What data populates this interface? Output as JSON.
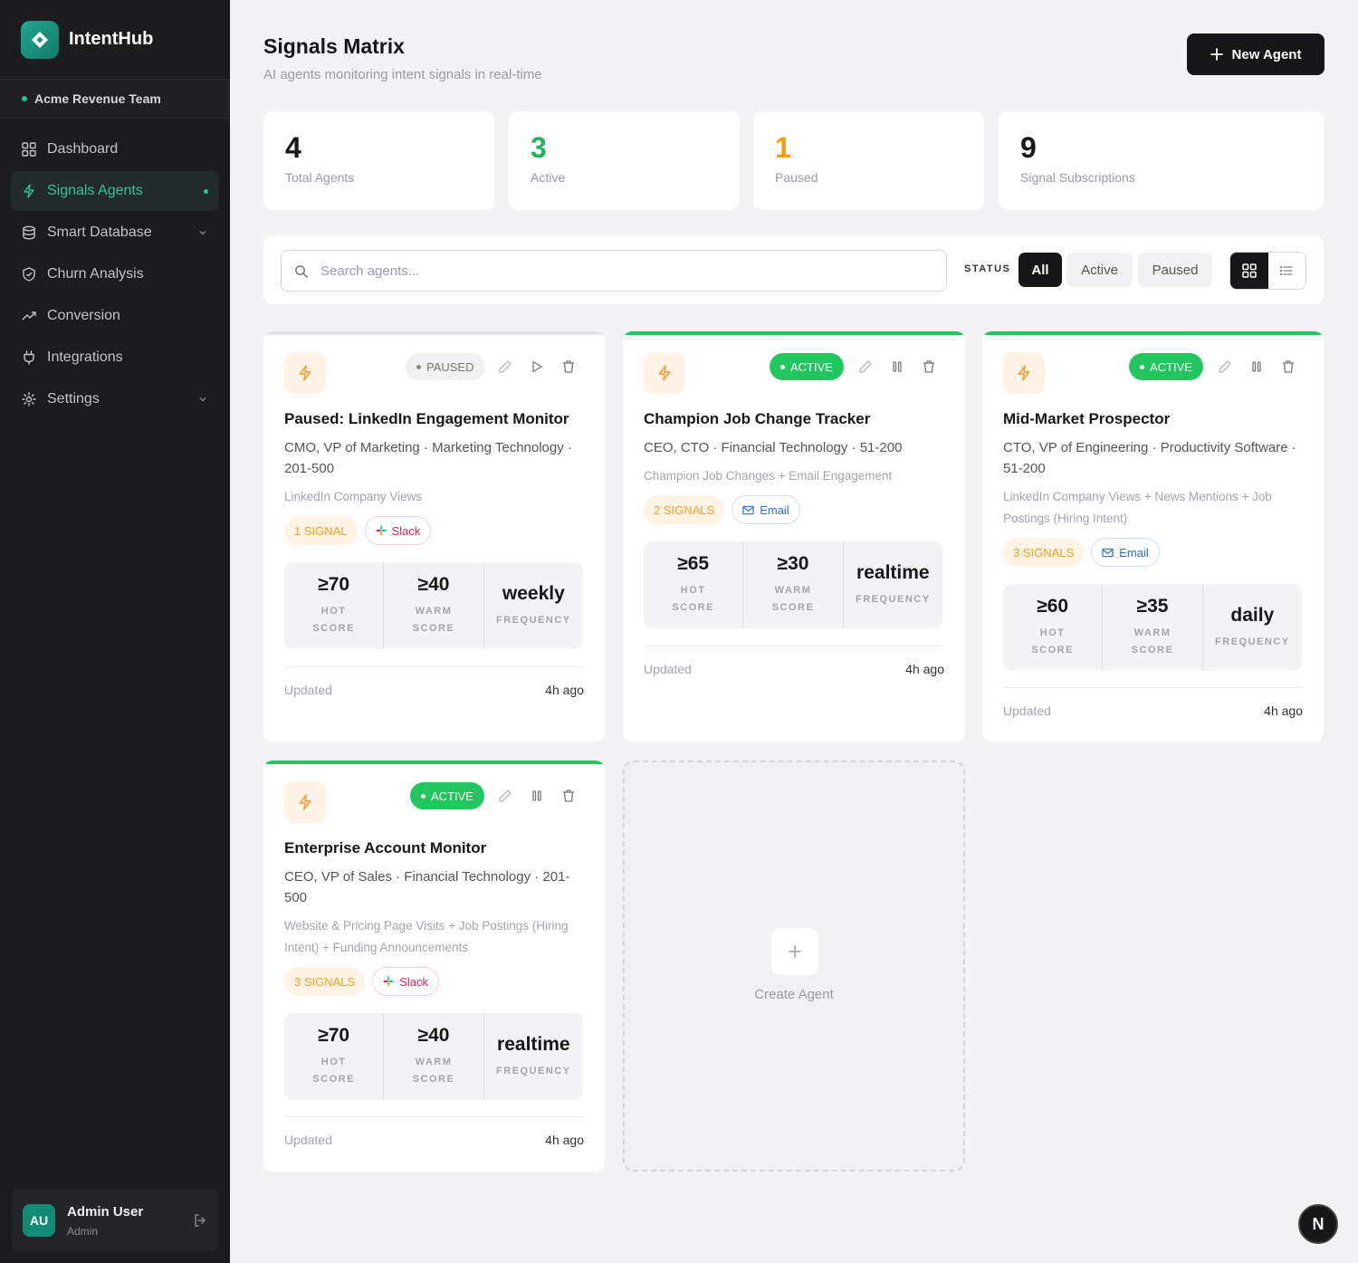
{
  "app": {
    "name": "IntentHub",
    "team": "Acme Revenue Team"
  },
  "nav": [
    {
      "label": "Dashboard",
      "icon": "grid-icon"
    },
    {
      "label": "Signals Agents",
      "icon": "bolt-icon",
      "active": true
    },
    {
      "label": "Smart Database",
      "icon": "database-icon",
      "expandable": true
    },
    {
      "label": "Churn Analysis",
      "icon": "shield-check-icon"
    },
    {
      "label": "Conversion",
      "icon": "trending-up-icon"
    },
    {
      "label": "Integrations",
      "icon": "plug-icon"
    },
    {
      "label": "Settings",
      "icon": "gear-icon",
      "expandable": true
    }
  ],
  "user": {
    "initials": "AU",
    "name": "Admin User",
    "role": "Admin"
  },
  "header": {
    "title": "Signals Matrix",
    "subtitle": "AI agents monitoring intent signals in real-time",
    "new_label": "New Agent"
  },
  "stats": [
    {
      "value": "4",
      "label": "Total Agents",
      "color": "#17171a"
    },
    {
      "value": "3",
      "label": "Active",
      "color": "#22b35e"
    },
    {
      "value": "1",
      "label": "Paused",
      "color": "#f59e0b"
    },
    {
      "value": "9",
      "label": "Signal Subscriptions",
      "color": "#17171a"
    }
  ],
  "toolbar": {
    "search_placeholder": "Search agents...",
    "status_label": "STATUS",
    "filters": [
      "All",
      "Active",
      "Paused"
    ]
  },
  "agents": [
    {
      "status": "PAUSED",
      "title": "Paused: LinkedIn Engagement Monitor",
      "desc": "CMO, VP of Marketing · Marketing Technology · 201-500",
      "signals": "LinkedIn Company Views",
      "signal_count": "1 SIGNAL",
      "channel": "Slack",
      "hot": "≥70",
      "hot_label": "HOT SCORE",
      "warm": "≥40",
      "warm_label": "WARM SCORE",
      "freq": "weekly",
      "freq_label": "FREQUENCY",
      "updated_label": "Updated",
      "updated": "4h ago"
    },
    {
      "status": "ACTIVE",
      "title": "Champion Job Change Tracker",
      "desc": "CEO, CTO · Financial Technology · 51-200",
      "signals": "Champion Job Changes + Email Engagement",
      "signal_count": "2 SIGNALS",
      "channel": "Email",
      "hot": "≥65",
      "hot_label": "HOT SCORE",
      "warm": "≥30",
      "warm_label": "WARM SCORE",
      "freq": "realtime",
      "freq_label": "FREQUENCY",
      "updated_label": "Updated",
      "updated": "4h ago"
    },
    {
      "status": "ACTIVE",
      "title": "Mid-Market Prospector",
      "desc": "CTO, VP of Engineering · Productivity Software · 51-200",
      "signals": "LinkedIn Company Views + News Mentions + Job Postings (Hiring Intent)",
      "signal_count": "3 SIGNALS",
      "channel": "Email",
      "hot": "≥60",
      "hot_label": "HOT SCORE",
      "warm": "≥35",
      "warm_label": "WARM SCORE",
      "freq": "daily",
      "freq_label": "FREQUENCY",
      "updated_label": "Updated",
      "updated": "4h ago"
    },
    {
      "status": "ACTIVE",
      "title": "Enterprise Account Monitor",
      "desc": "CEO, VP of Sales · Financial Technology · 201-500",
      "signals": "Website & Pricing Page Visits + Job Postings (Hiring Intent) + Funding Announcements",
      "signal_count": "3 SIGNALS",
      "channel": "Slack",
      "hot": "≥70",
      "hot_label": "HOT SCORE",
      "warm": "≥40",
      "warm_label": "WARM SCORE",
      "freq": "realtime",
      "freq_label": "FREQUENCY",
      "updated_label": "Updated",
      "updated": "4h ago"
    }
  ],
  "create": {
    "label": "Create Agent"
  },
  "floating": {
    "label": "N"
  },
  "colors": {
    "accent": "#2ec4a0",
    "active": "#22c55e",
    "signal": "#f0a020",
    "slack": "#e1245a",
    "email": "#2a6fd6"
  }
}
